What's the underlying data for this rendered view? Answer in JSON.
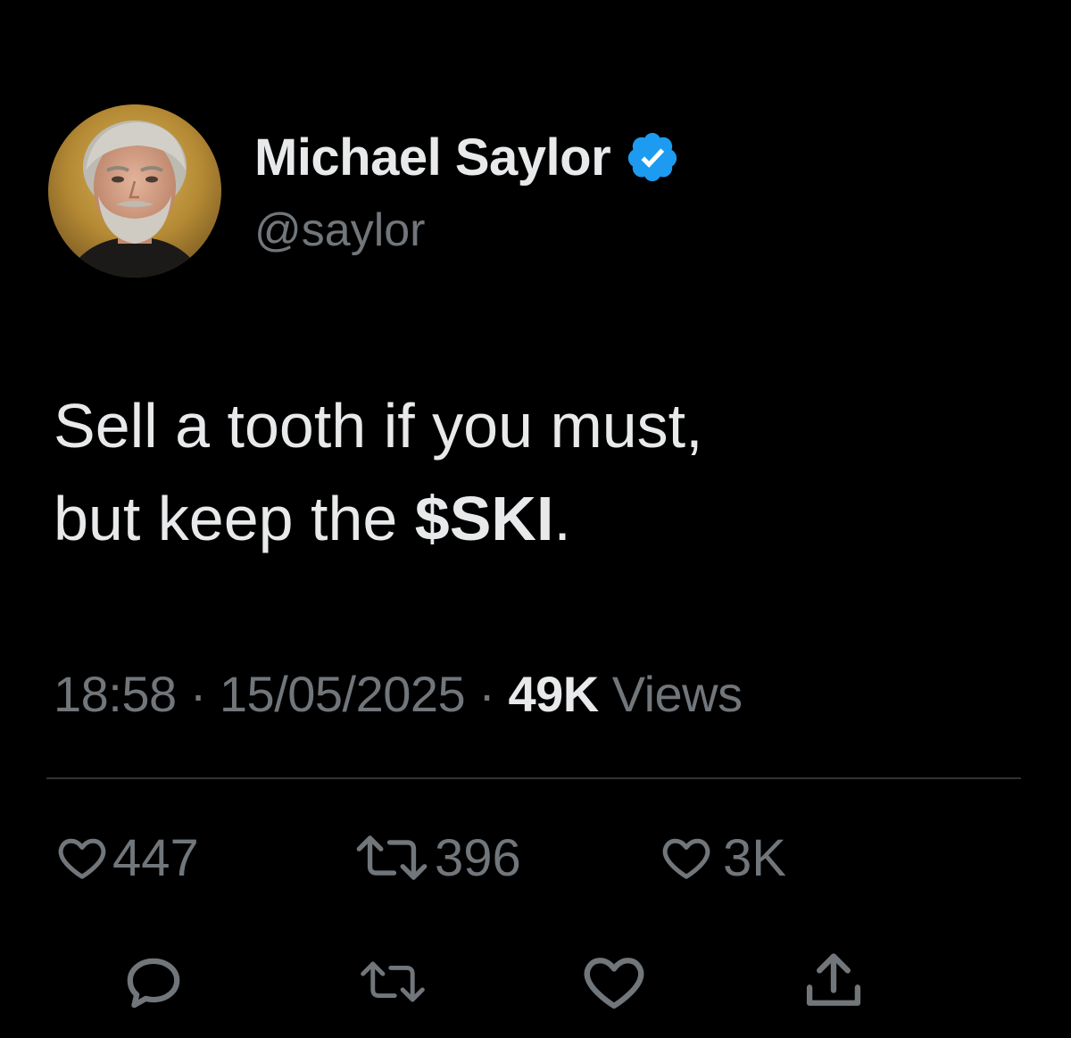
{
  "author": {
    "name": "Michael Saylor",
    "handle": "@saylor",
    "verified_color": "#1d9bf0"
  },
  "tweet": {
    "line1": "Sell a tooth if you must,",
    "line2_prefix": "but keep the ",
    "cashtag": "$SKI",
    "line2_suffix": "."
  },
  "meta": {
    "time": "18:58",
    "separator": " · ",
    "date": "15/05/2025",
    "views_count": "49K",
    "views_label": " Views"
  },
  "stats": {
    "replies": "447",
    "reposts": "396",
    "likes": "3K"
  },
  "icons": {
    "stat_replies": "heart-icon",
    "stat_reposts": "repost-icon",
    "stat_likes": "heart-icon",
    "actions": [
      "reply-icon",
      "repost-icon",
      "like-icon",
      "share-icon"
    ]
  },
  "colors": {
    "background": "#000000",
    "text_primary": "#e7e9ea",
    "text_secondary": "#71767b",
    "divider": "#2f3336"
  }
}
